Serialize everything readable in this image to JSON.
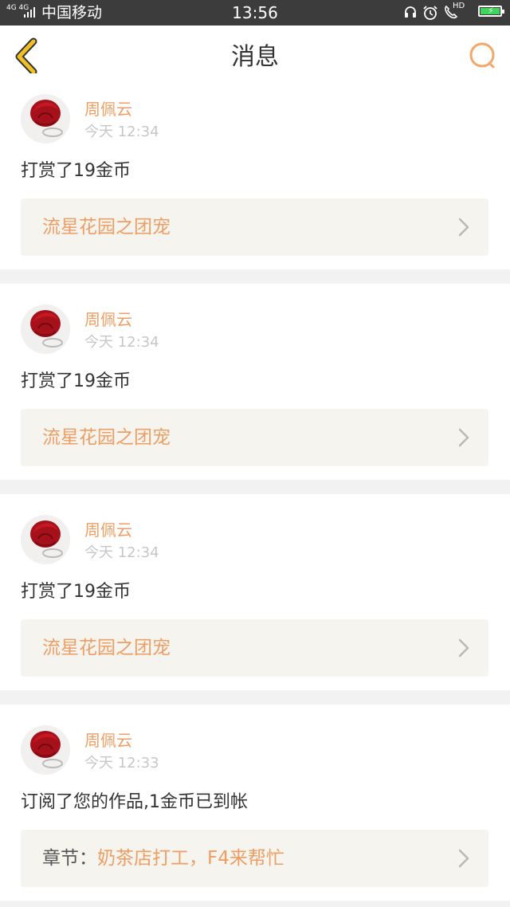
{
  "status_bar": {
    "network": "4G 4G",
    "carrier": "中国移动",
    "time": "13:56",
    "hd_label": "HD",
    "battery_color": "#3cd65a"
  },
  "nav": {
    "back_icon": "chevron-left-icon",
    "title": "消息",
    "search_icon": "search-icon",
    "accent_color": "#f0c022"
  },
  "messages": [
    {
      "user": "周佩云",
      "time": "今天 12:34",
      "text": "打赏了19金币",
      "link_prefix": "",
      "link": "流星花园之团宠"
    },
    {
      "user": "周佩云",
      "time": "今天 12:34",
      "text": "打赏了19金币",
      "link_prefix": "",
      "link": "流星花园之团宠"
    },
    {
      "user": "周佩云",
      "time": "今天 12:34",
      "text": "打赏了19金币",
      "link_prefix": "",
      "link": "流星花园之团宠"
    },
    {
      "user": "周佩云",
      "time": "今天 12:33",
      "text": "订阅了您的作品,1金币已到帐",
      "link_prefix": "章节：",
      "link": "奶茶店打工，F4来帮忙"
    }
  ],
  "colors": {
    "name": "#ee9e63",
    "link": "#ee9e63",
    "time": "#c7c7c7",
    "search": "#f3a768"
  }
}
